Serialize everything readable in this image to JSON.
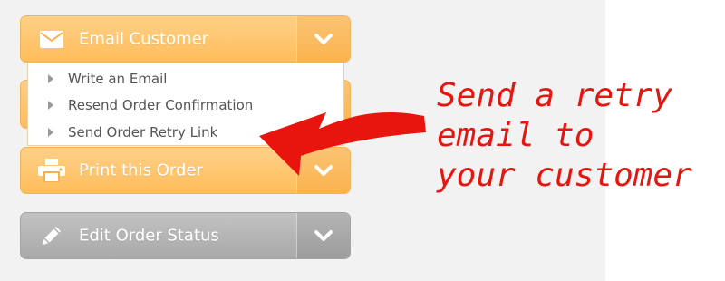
{
  "actions": {
    "email": {
      "label": "Email Customer",
      "icon": "envelope-icon"
    },
    "print": {
      "label": "Print this Order",
      "icon": "printer-icon"
    },
    "edit": {
      "label": "Edit Order Status",
      "icon": "pencil-icon"
    }
  },
  "email_menu": {
    "items": [
      {
        "label": "Write an Email"
      },
      {
        "label": "Resend Order Confirmation"
      },
      {
        "label": "Send Order Retry Link"
      }
    ]
  },
  "annotation": {
    "lines": [
      "Send a retry",
      "email to",
      "your customer"
    ],
    "color": "#e8150f"
  },
  "colors": {
    "orange_button": "#ffc56f",
    "gray_button": "#b5b5b5",
    "panel_background": "#f2f2f2"
  }
}
